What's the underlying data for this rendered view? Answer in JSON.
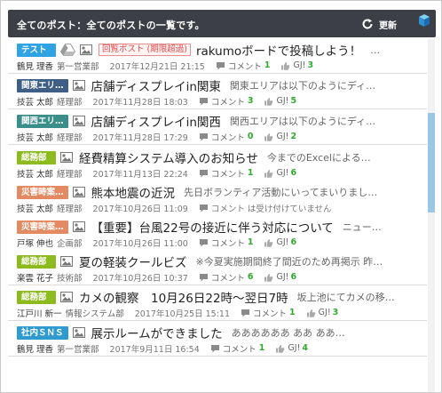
{
  "header": {
    "title": "全てのポスト：全てのポストの一覧です。",
    "refresh_label": "更新"
  },
  "posts": [
    {
      "tag": "テスト",
      "tag_color": "#2fa3e3",
      "has_drive": true,
      "status": "回覧ポスト (期限超過)",
      "title": "rakumoボードで投稿しよう！",
      "excerpt": "…",
      "author": "鶴見 理香",
      "dept": "第一営業部",
      "date": "2017年12月21日 21:15",
      "comment_label": "コメント",
      "comments": "1",
      "gj_label": "GJ!",
      "gj": "3"
    },
    {
      "tag": "関東エリ…",
      "tag_color": "#3f5e85",
      "title": "店舗ディスプレイin関東",
      "excerpt": "関東エリアは以下のようにディ…",
      "author": "技芸 太郎",
      "dept": "経理部",
      "date": "2017年11月28日 18:03",
      "comment_label": "コメント",
      "comments": "3",
      "gj_label": "GJ!",
      "gj": "5"
    },
    {
      "tag": "関西エリ…",
      "tag_color": "#3b8f8a",
      "title": "店舗ディスプレイin関西",
      "excerpt": "関西エリアは以下のようにディ…",
      "author": "技芸 太郎",
      "dept": "経理部",
      "date": "2017年11月28日 17:29",
      "comment_label": "コメント",
      "comments": "0",
      "gj_label": "GJ!",
      "gj": "2"
    },
    {
      "tag": "総務部",
      "tag_color": "#8dbb1d",
      "title": "経費精算システム導入のお知らせ",
      "excerpt": "今までのExcelによる…",
      "author": "技芸 太郎",
      "dept": "経理部",
      "date": "2017年11月13日 22:24",
      "comment_label": "コメント",
      "comments": "1",
      "gj_label": "GJ!",
      "gj": "6"
    },
    {
      "tag": "災害時案…",
      "tag_color": "#e38a62",
      "title": "熊本地震の近況",
      "excerpt": "先日ボランティア活動にいってまいりまし…",
      "author": "技芸 太郎",
      "dept": "経理部",
      "date": "2017年10月26日 11:09",
      "note": "コメント は受け付けていません"
    },
    {
      "tag": "災害時案…",
      "tag_color": "#e38a62",
      "title": "【重要】台風22号の接近に伴う対応について",
      "excerpt": "ニュー…",
      "author": "戸塚 伸也",
      "dept": "企画部",
      "date": "2017年10月26日 11:00",
      "comment_label": "コメント",
      "comments": "1",
      "gj_label": "GJ!",
      "gj": "6"
    },
    {
      "tag": "総務部",
      "tag_color": "#8dbb1d",
      "title": "夏の軽装クールビズ",
      "excerpt": "※今夏実施期間終了間近のため再掲示 昨…",
      "author": "楽雲 花子",
      "dept": "技術部",
      "date": "2017年10月26日 10:37",
      "comment_label": "コメント",
      "comments": "6",
      "gj_label": "GJ!",
      "gj": "6"
    },
    {
      "tag": "総務部",
      "tag_color": "#8dbb1d",
      "title": "カメの観察　10月26日22時〜翌日7時",
      "excerpt": "坂上池にてカメの移…",
      "author": "江戸川 新一",
      "dept": "情報システム部",
      "date": "2017年10月25日 15:11",
      "comment_label": "コメント",
      "comments": "1",
      "gj_label": "GJ!",
      "gj": "3"
    },
    {
      "tag": "社内ＳＮＳ",
      "tag_color": "#2f9ad0",
      "title": "展示ルームができました",
      "excerpt": "ああああああ ああ ああ…",
      "author": "鶴見 理香",
      "dept": "第一営業部",
      "date": "2017年9月11日 16:54",
      "comment_label": "コメント",
      "comments": "1",
      "gj_label": "GJ!",
      "gj": "4"
    }
  ]
}
